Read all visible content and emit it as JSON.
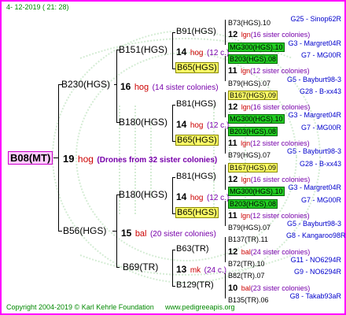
{
  "header": {
    "timestamp": "4- 12-2019 ( 21: 28)"
  },
  "root": {
    "name": "B08(MT)",
    "gen": "19",
    "race": "hog",
    "note": "(Drones from 32 sister colonies)"
  },
  "b230": {
    "name": "B230(HGS)",
    "gen": "16",
    "race": "hog",
    "note": "(14 sister colonies)"
  },
  "b56": {
    "name": "B56(HGS)",
    "gen": "15",
    "race": "bal",
    "note": "(20 sister colonies)"
  },
  "b151": {
    "name": "B151(HGS)",
    "gen": "14",
    "race": "hog",
    "note": "(12 c.)"
  },
  "b180a": {
    "name": "B180(HGS)",
    "gen": "14",
    "race": "hog",
    "note": "(12 c.)"
  },
  "b180b": {
    "name": "B180(HGS)",
    "gen": "14",
    "race": "hog",
    "note": "(12 c.)"
  },
  "b69": {
    "name": "B69(TR)",
    "gen": "13",
    "race": "mk",
    "note": "(24 c.)"
  },
  "g3": [
    {
      "name": "B91(HGS)"
    },
    {
      "name": "B65(HGS)"
    },
    {
      "name": "B81(HGS)"
    },
    {
      "name": "B65(HGS)"
    },
    {
      "name": "B81(HGS)"
    },
    {
      "name": "B65(HGS)"
    },
    {
      "name": "B63(TR)"
    },
    {
      "name": "B129(TR)"
    }
  ],
  "g4": [
    {
      "name": "B73(HGS).10",
      "loc": "G25 - Sinop62R"
    },
    {
      "gen": "12",
      "race": "lgn",
      "note": "(16 sister colonies)"
    },
    {
      "name": "MG300(HGS).10",
      "loc": "G3 - Margret04R"
    },
    {
      "name": "B203(HGS).08",
      "loc": "G7 - MG00R"
    },
    {
      "gen": "11",
      "race": "lgn",
      "note": "(12 sister colonies)"
    },
    {
      "name": "B79(HGS).07",
      "loc": "G5 - Bayburt98-3"
    },
    {
      "name": "B167(HGS).09",
      "loc": "G28 - B-xx43"
    },
    {
      "gen": "12",
      "race": "lgn",
      "note": "(16 sister colonies)"
    },
    {
      "name": "MG300(HGS).10",
      "loc": "G3 - Margret04R"
    },
    {
      "name": "B203(HGS).08",
      "loc": "G7 - MG00R"
    },
    {
      "gen": "11",
      "race": "lgn",
      "note": "(12 sister colonies)"
    },
    {
      "name": "B79(HGS).07",
      "loc": "G5 - Bayburt98-3"
    },
    {
      "name": "B167(HGS).09",
      "loc": "G28 - B-xx43"
    },
    {
      "gen": "12",
      "race": "lgn",
      "note": "(16 sister colonies)"
    },
    {
      "name": "MG300(HGS).10",
      "loc": "G3 - Margret04R"
    },
    {
      "name": "B203(HGS).08",
      "loc": "G7 - MG00R"
    },
    {
      "gen": "11",
      "race": "lgn",
      "note": "(12 sister colonies)"
    },
    {
      "name": "B79(HGS).07",
      "loc": "G5 - Bayburt98-3"
    },
    {
      "name": "B137(TR).11",
      "loc": "G8 - Kangaroo98R"
    },
    {
      "gen": "12",
      "race": "bal",
      "note": "(24 sister colonies)"
    },
    {
      "name": "B72(TR).10",
      "loc": "G11 - NO6294R"
    },
    {
      "name": "B82(TR).07",
      "loc": "G9 - NO6294R"
    },
    {
      "gen": "10",
      "race": "bal",
      "note": "(23 sister colonies)"
    },
    {
      "name": "B135(TR).06",
      "loc": "G8 - Takab93aR"
    }
  ],
  "footer": {
    "copyright": "Copyright 2004-2019 © Karl Kehrle Foundation",
    "url": "www.pedigreeapis.org"
  }
}
